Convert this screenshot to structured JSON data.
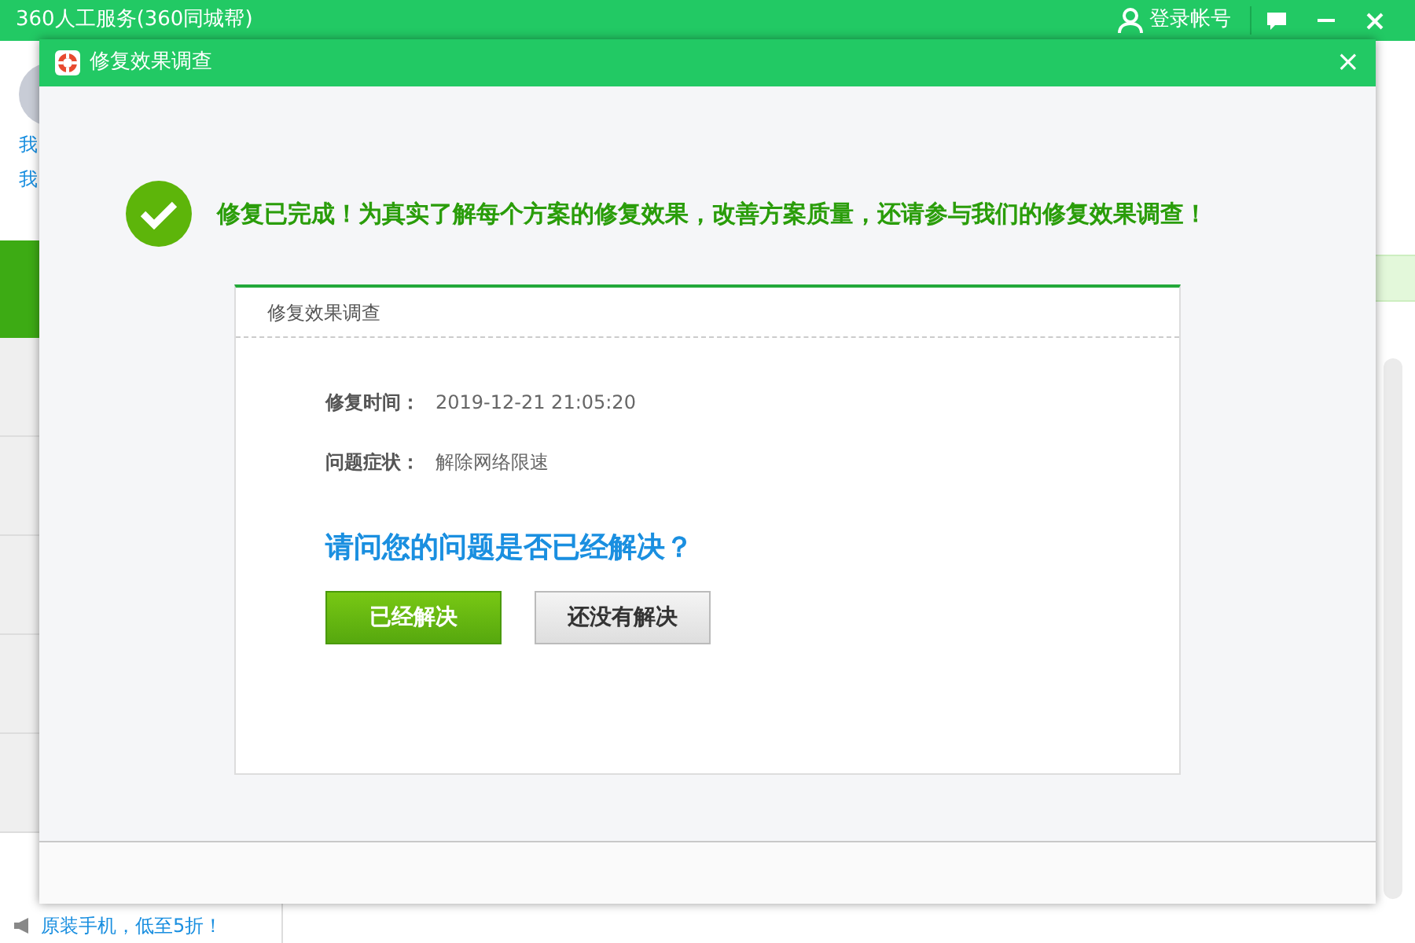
{
  "app": {
    "title": "360人工服务(360同城帮)",
    "login": "登录帐号",
    "sidebar_links": [
      "我",
      "我"
    ],
    "promo": "原装手机，低至5折！"
  },
  "dialog": {
    "title": "修复效果调查",
    "close": "×",
    "message": "修复已完成！为真实了解每个方案的修复效果，改善方案质量，还请参与我们的修复效果调查！",
    "survey": {
      "heading": "修复效果调查",
      "fields": [
        {
          "label": "修复时间：",
          "value": "2019-12-21 21:05:20"
        },
        {
          "label": "问题症状：",
          "value": "解除网络限速"
        }
      ],
      "question": "请问您的问题是否已经解决？",
      "buttons": [
        {
          "label": "已经解决",
          "kind": "primary"
        },
        {
          "label": "还没有解决",
          "kind": "secondary"
        }
      ]
    }
  }
}
